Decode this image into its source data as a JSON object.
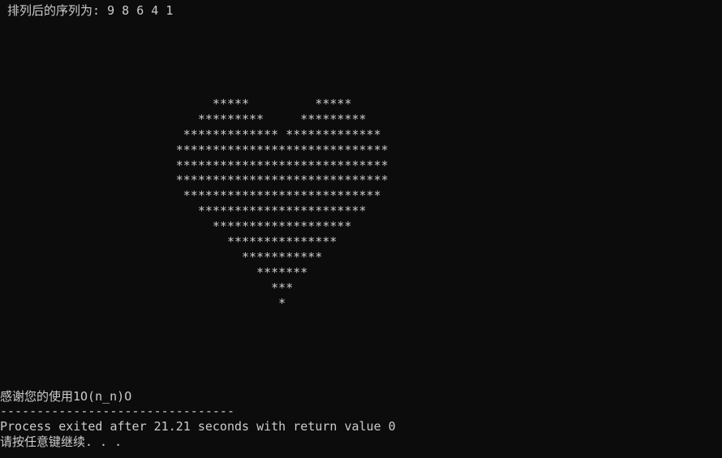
{
  "console": {
    "header_line": " 排列后的序列为: 9 8 6 4 1",
    "heart_rows": [
      "                             *****         *****",
      "                           *********     *********",
      "                         ************* *************",
      "                        *****************************",
      "                        *****************************",
      "                        *****************************",
      "                         ***************************",
      "                           ***********************",
      "                             *******************",
      "                               ***************",
      "                                 ***********",
      "                                   *******",
      "                                     ***",
      "                                      *"
    ],
    "thanks_line": "感谢您的使用1O(n_n)O",
    "separator_line": "--------------------------------",
    "process_line": "Process exited after 21.21 seconds with return value 0",
    "press_key_line": "请按任意键继续. . ."
  },
  "colors": {
    "background": "#0c0c0c",
    "text": "#cccccc"
  }
}
